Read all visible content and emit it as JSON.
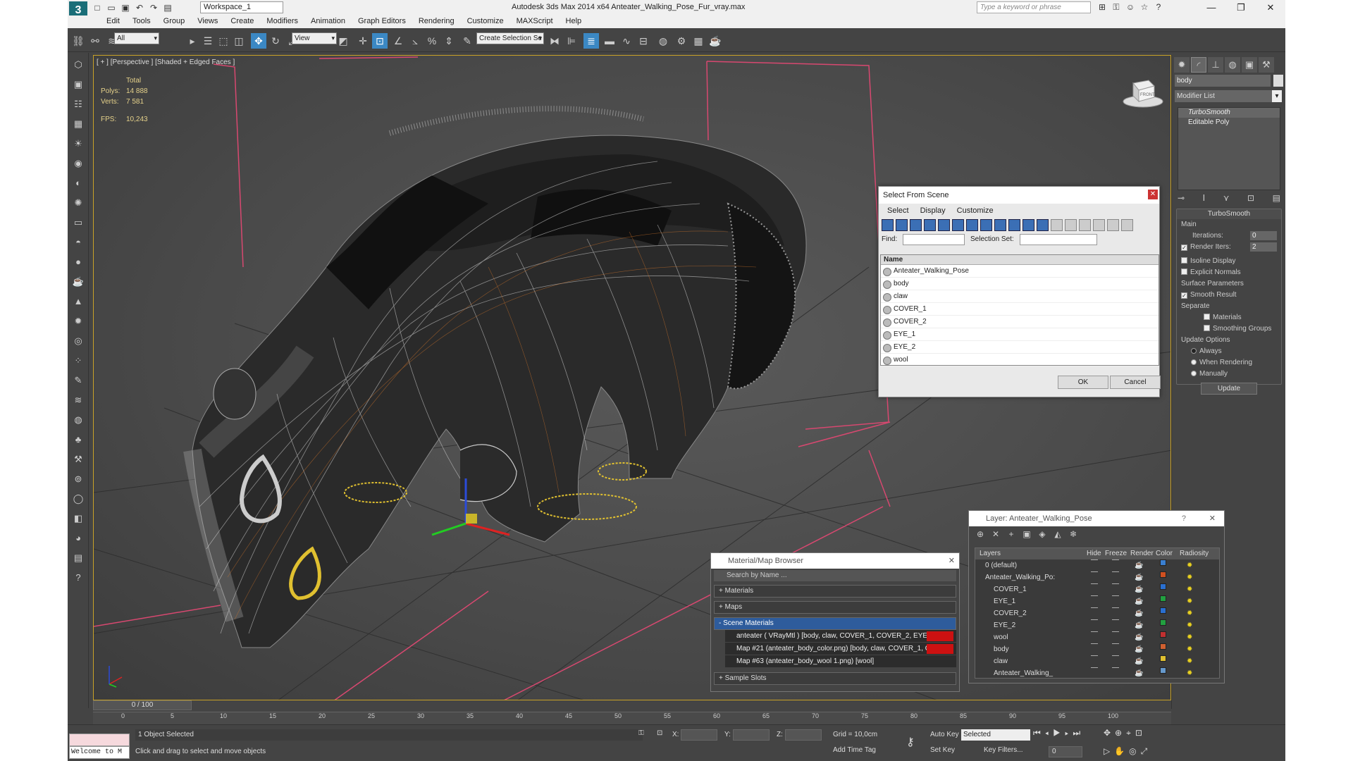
{
  "window": {
    "title": "Autodesk 3ds Max  2014 x64     Anteater_Walking_Pose_Fur_vray.max",
    "workspace": "Workspace_1",
    "search_placeholder": "Type a keyword or phrase"
  },
  "menu": [
    "Edit",
    "Tools",
    "Group",
    "Views",
    "Create",
    "Modifiers",
    "Animation",
    "Graph Editors",
    "Rendering",
    "Customize",
    "MAXScript",
    "Help"
  ],
  "toolbar": {
    "selection_filter": "All",
    "ref_coord": "View",
    "named_selection": "Create Selection Se"
  },
  "viewport": {
    "label": "[ + ] [Perspective ] [Shaded + Edged Faces ]",
    "stats": {
      "total_label": "Total",
      "polys_label": "Polys:",
      "polys": "14 888",
      "verts_label": "Verts:",
      "verts": "7 581",
      "fps_label": "FPS:",
      "fps": "10,243"
    },
    "viewcube_label": "FRONT"
  },
  "command_panel": {
    "object_name": "body",
    "modifier_list": "Modifier List",
    "stack": [
      "TurboSmooth",
      "Editable Poly"
    ],
    "rollout_title": "TurboSmooth",
    "main_label": "Main",
    "iterations_label": "Iterations:",
    "iterations": "0",
    "render_iters_label": "Render Iters:",
    "render_iters": "2",
    "isoline": "Isoline Display",
    "explicit_normals": "Explicit Normals",
    "surface_params": "Surface Parameters",
    "smooth_result": "Smooth Result",
    "separate": "Separate",
    "materials": "Materials",
    "smoothing_groups": "Smoothing Groups",
    "update_options": "Update Options",
    "always": "Always",
    "when_rendering": "When Rendering",
    "manually": "Manually",
    "update_btn": "Update"
  },
  "select_from_scene": {
    "title": "Select From Scene",
    "menu": [
      "Select",
      "Display",
      "Customize"
    ],
    "find_label": "Find:",
    "selection_set_label": "Selection Set:",
    "col_name": "Name",
    "items": [
      "Anteater_Walking_Pose",
      "body",
      "claw",
      "COVER_1",
      "COVER_2",
      "EYE_1",
      "EYE_2",
      "wool"
    ],
    "ok": "OK",
    "cancel": "Cancel"
  },
  "material_browser": {
    "title": "Material/Map Browser",
    "search": "Search by Name ...",
    "groups": [
      "+ Materials",
      "+ Maps",
      "- Scene Materials"
    ],
    "scene_items": [
      "anteater  ( VRayMtl )  [body, claw, COVER_1, COVER_2, EYE_1,...",
      "Map #21 (anteater_body_color.png)  [body, claw, COVER_1, CO...",
      "Map #63 (anteater_body_wool 1.png)  [wool]"
    ],
    "sample_slots": "+ Sample Slots"
  },
  "layer_window": {
    "title": "Layer: Anteater_Walking_Pose",
    "help": "?",
    "headers": [
      "Layers",
      "Hide",
      "Freeze",
      "Render",
      "Color",
      "Radiosity"
    ],
    "rows": [
      {
        "name": "0 (default)",
        "indent": 1,
        "color": "#3a7fd0"
      },
      {
        "name": "Anteater_Walking_Po:",
        "indent": 1,
        "color": "#d05020"
      },
      {
        "name": "COVER_1",
        "indent": 2,
        "color": "#2a6fd0"
      },
      {
        "name": "EYE_1",
        "indent": 2,
        "color": "#22a040"
      },
      {
        "name": "COVER_2",
        "indent": 2,
        "color": "#2a6fd0"
      },
      {
        "name": "EYE_2",
        "indent": 2,
        "color": "#22a040"
      },
      {
        "name": "wool",
        "indent": 2,
        "color": "#c03030"
      },
      {
        "name": "body",
        "indent": 2,
        "color": "#d06030"
      },
      {
        "name": "claw",
        "indent": 2,
        "color": "#e0c030"
      },
      {
        "name": "Anteater_Walking_",
        "indent": 2,
        "color": "#6699cc"
      }
    ]
  },
  "timeline": {
    "slider": "0 / 100",
    "ticks": [
      "0",
      "5",
      "10",
      "15",
      "20",
      "25",
      "30",
      "35",
      "40",
      "45",
      "50",
      "55",
      "60",
      "65",
      "70",
      "75",
      "80",
      "85",
      "90",
      "95",
      "100"
    ]
  },
  "status": {
    "selected": "1 Object Selected",
    "prompt": "Click and drag to select and move objects",
    "maxscript": "Welcome to M",
    "x_label": "X:",
    "y_label": "Y:",
    "z_label": "Z:",
    "grid": "Grid = 10,0cm",
    "auto_key": "Auto Key",
    "set_key": "Set Key",
    "key_mode": "Selected",
    "key_filters": "Key Filters...",
    "add_time_tag": "Add Time Tag",
    "frame": "0"
  }
}
